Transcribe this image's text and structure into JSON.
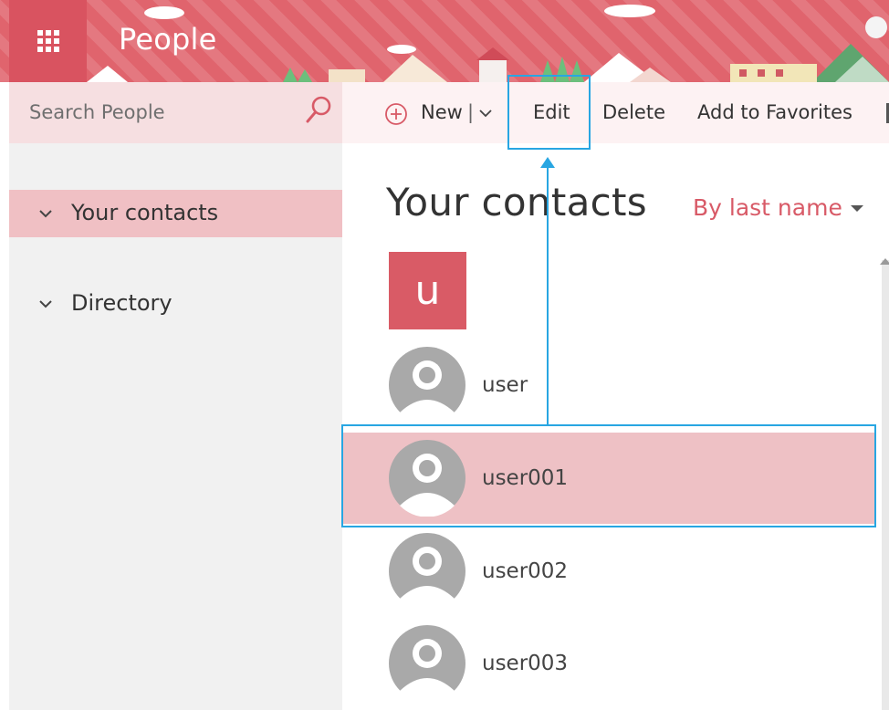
{
  "header": {
    "app_title": "People",
    "waffle_icon": "app-launcher-icon",
    "brand_color": "#e0646d"
  },
  "search": {
    "placeholder": "Search People",
    "value": "",
    "icon": "search-icon"
  },
  "toolbar": {
    "new_label": "New",
    "separator": "|",
    "edit_label": "Edit",
    "delete_label": "Delete",
    "favorites_label": "Add to Favorites"
  },
  "nav": {
    "items": [
      {
        "label": "Your contacts",
        "selected": true
      },
      {
        "label": "Directory",
        "selected": false
      }
    ],
    "selected_color": "#f0c0c4"
  },
  "main": {
    "title": "Your contacts",
    "sort_label": "By last name",
    "letter_tile": "u",
    "accent_color": "#d85a67"
  },
  "contacts": [
    {
      "name": "user",
      "selected": false
    },
    {
      "name": "user001",
      "selected": true
    },
    {
      "name": "user002",
      "selected": false
    },
    {
      "name": "user003",
      "selected": false
    }
  ],
  "annotation": {
    "color": "#28a6e2"
  }
}
